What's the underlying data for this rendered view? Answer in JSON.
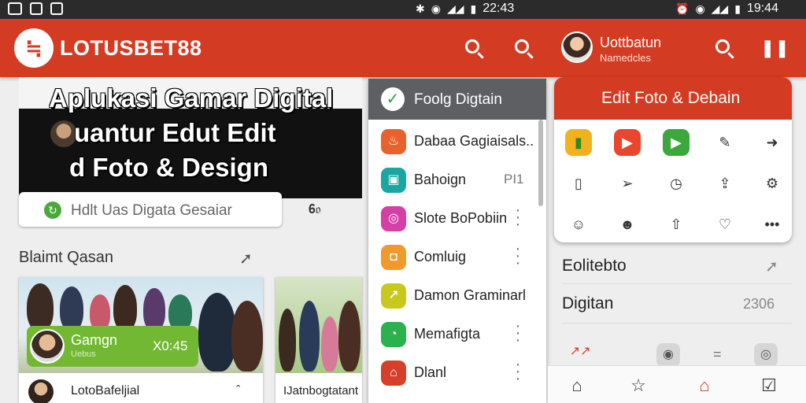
{
  "status_bar": {
    "left_time": "22:43",
    "right_time": "19:44"
  },
  "app_bar": {
    "brand": "LOTUSBET88",
    "logo_mark": "≒",
    "user_name": "Uottbatun",
    "user_sub": "Namedcles"
  },
  "hero": {
    "line1": "Aplukasi Gamar Digital",
    "line2": "uantur Edut Edit",
    "line3": "d Foto & Design"
  },
  "search_card": {
    "text": "Hdlt Uas Digata Gesaiar",
    "icon": "refresh-icon",
    "aux": "𝟔𝔬"
  },
  "section": {
    "title": "Blaimt Qasan"
  },
  "photo_card": {
    "pill_title": "Gamgn",
    "pill_sub": "Uebus",
    "pill_time": "X0:45",
    "footer_name": "LotoBafeljial",
    "footer_chevron": "ˆ"
  },
  "photo_card2": {
    "name": "IJatnbogtatant"
  },
  "menu": {
    "header": "Foolg Digtain",
    "items": [
      {
        "label": "Dabaa Gagiaisals..",
        "color": "#e8632c",
        "glyph": "♨",
        "extra": "",
        "kebab": false
      },
      {
        "label": "Bahoign",
        "color": "#1ba7a1",
        "glyph": "▣",
        "extra": "PI1",
        "kebab": false
      },
      {
        "label": "Slote BoPobiin",
        "color": "#d63fa8",
        "glyph": "◎",
        "extra": "",
        "kebab": true
      },
      {
        "label": "Comluig",
        "color": "#f19a2c",
        "glyph": "◘",
        "extra": "",
        "kebab": true
      },
      {
        "label": "Damon Graminarl",
        "color": "#c8c81f",
        "glyph": "↗",
        "extra": "",
        "kebab": false
      },
      {
        "label": "Memafigta",
        "color": "#2bb24c",
        "glyph": "◔",
        "extra": "",
        "kebab": true
      },
      {
        "label": "Dlanl",
        "color": "#d6402a",
        "glyph": "⌂",
        "extra": "",
        "kebab": true
      }
    ]
  },
  "edit_card": {
    "title": "Edit Foto & Debain"
  },
  "right_rows": {
    "row1": "Eolitebto",
    "row2": "Digitan",
    "row2_aux": "2306",
    "equals": "="
  },
  "colors": {
    "brand_red": "#d43b23",
    "green": "#72b833",
    "menu_header": "#5d5f63"
  }
}
